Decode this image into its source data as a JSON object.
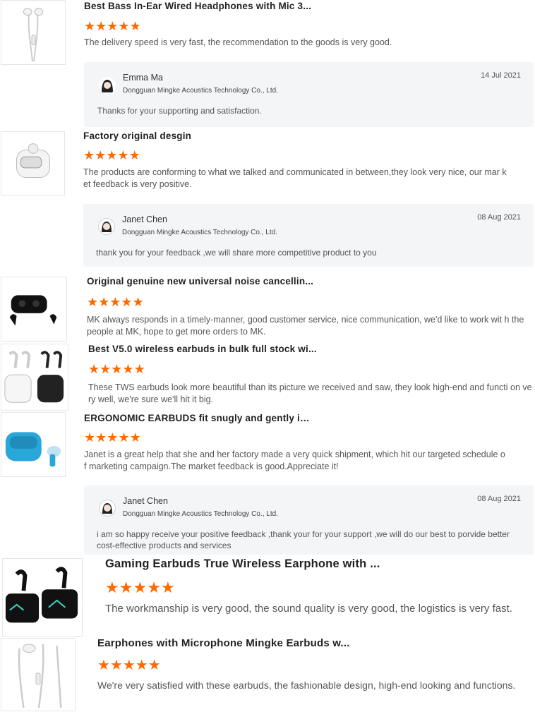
{
  "colors": {
    "star": "#ff6a00",
    "reply_bg": "#f4f5f7"
  },
  "reviews": [
    {
      "title": "Best Bass In-Ear Wired Headphones with Mic 3...",
      "stars": [
        "★",
        "★",
        "★",
        "★",
        "★"
      ],
      "rating": 5,
      "text": "The delivery speed is very fast, the recommendation to the goods is very good.",
      "image_icon": "wired-earphones-icon",
      "reply": {
        "name": "Emma Ma",
        "company": "Dongguan Mingke Acoustics Technology Co., Ltd.",
        "date": "14 Jul 2021",
        "text": "Thanks for your supporting and satisfaction.",
        "avatar_icon": "female-avatar-icon"
      }
    },
    {
      "title": "Factory original desgin",
      "stars": [
        "★",
        "★",
        "★",
        "★",
        "★"
      ],
      "rating": 5,
      "text": "The products are conforming to what we talked and communicated in between,they look very nice, our mar ket feedback is very positive.",
      "image_icon": "white-earbuds-case-icon",
      "reply": {
        "name": "Janet Chen",
        "company": "Dongguan Mingke Acoustics Technology Co., Ltd.",
        "date": "08 Aug 2021",
        "text": "thank you for your feedback ,we will share more competitive product to you",
        "avatar_icon": "female-avatar-icon"
      }
    },
    {
      "title": "Original genuine new universal noise cancellin...",
      "stars": [
        "★",
        "★",
        "★",
        "★",
        "★"
      ],
      "rating": 5,
      "text": "MK always responds in a timely-manner, good customer service, nice communication, we'd like to work wit h the people at MK, hope to get more orders to MK.",
      "image_icon": "black-earbuds-case-icon"
    },
    {
      "title": "Best V5.0 wireless earbuds in bulk full stock wi...",
      "stars": [
        "★",
        "★",
        "★",
        "★",
        "★"
      ],
      "rating": 5,
      "text": "These TWS earbuds look more beautiful than its picture we received and saw, they look high-end and functi on very well, we're sure we'll hit it big.",
      "image_icon": "tws-earbuds-icon"
    },
    {
      "title": "ERGONOMIC EARBUDS fit snugly and gently in ...",
      "stars": [
        "★",
        "★",
        "★",
        "★",
        "★"
      ],
      "rating": 5,
      "text": "Janet is a great help that she and her factory made a very quick shipment, which hit our targeted schedule of marketing campaign.The market feedback is good.Appreciate it!",
      "image_icon": "blue-earbuds-case-icon",
      "reply": {
        "name": "Janet Chen",
        "company": "Dongguan Mingke Acoustics Technology Co., Ltd.",
        "date": "08 Aug 2021",
        "text": "i am so happy receive your positive feedback ,thank your for your support ,we will do our best to porvide better cost-effective products and services",
        "avatar_icon": "female-avatar-icon"
      }
    },
    {
      "title": "Gaming Earbuds True Wireless Earphone with ...",
      "stars": [
        "★",
        "★",
        "★",
        "★",
        "★"
      ],
      "rating": 5,
      "text": "The workmanship is very good, the sound quality is very good, the logistics is very fast.",
      "image_icon": "gaming-earbuds-icon"
    },
    {
      "title": "Earphones with Microphone Mingke Earbuds w...",
      "stars": [
        "★",
        "★",
        "★",
        "★",
        "★"
      ],
      "rating": 5,
      "text": "We're very satisfied with these earbuds, the fashionable design, high-end looking and functions.",
      "image_icon": "wired-earphones-icon"
    }
  ]
}
